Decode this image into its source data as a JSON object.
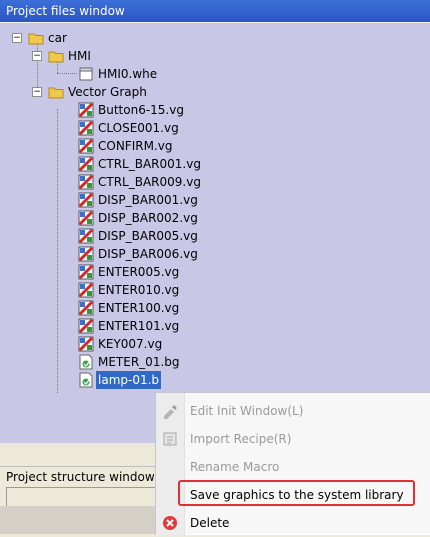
{
  "window": {
    "title": "Project files window"
  },
  "tree": {
    "root": {
      "label": "car"
    },
    "hmi_folder": {
      "label": "HMI"
    },
    "hmi_file": {
      "label": "HMI0.whe"
    },
    "vg_folder": {
      "label": "Vector Graph"
    },
    "files": [
      "Button6-15.vg",
      "CLOSE001.vg",
      "CONFIRM.vg",
      "CTRL_BAR001.vg",
      "CTRL_BAR009.vg",
      "DISP_BAR001.vg",
      "DISP_BAR002.vg",
      "DISP_BAR005.vg",
      "DISP_BAR006.vg",
      "ENTER005.vg",
      "ENTER010.vg",
      "ENTER100.vg",
      "ENTER101.vg",
      "KEY007.vg"
    ],
    "bg_files": [
      "METER_01.bg",
      "lamp-01.b"
    ]
  },
  "structure": {
    "title": "Project structure window"
  },
  "context_menu": {
    "items": [
      {
        "label": "Edit Init Window(L)",
        "enabled": false,
        "icon": "edit-window-icon"
      },
      {
        "label": "Import Recipe(R)",
        "enabled": false,
        "icon": "import-recipe-icon"
      },
      {
        "label": "Rename Macro",
        "enabled": false,
        "icon": ""
      },
      {
        "label": "Save graphics to the system library",
        "enabled": true,
        "icon": ""
      },
      {
        "label": "Delete",
        "enabled": true,
        "icon": "delete-icon"
      }
    ],
    "highlight_color": "#e03030"
  },
  "colors": {
    "tree_bg": "#c8c8e6",
    "title_bar": "#2a56c4",
    "selection": "#3169c6",
    "folder": "#f2c84b"
  }
}
